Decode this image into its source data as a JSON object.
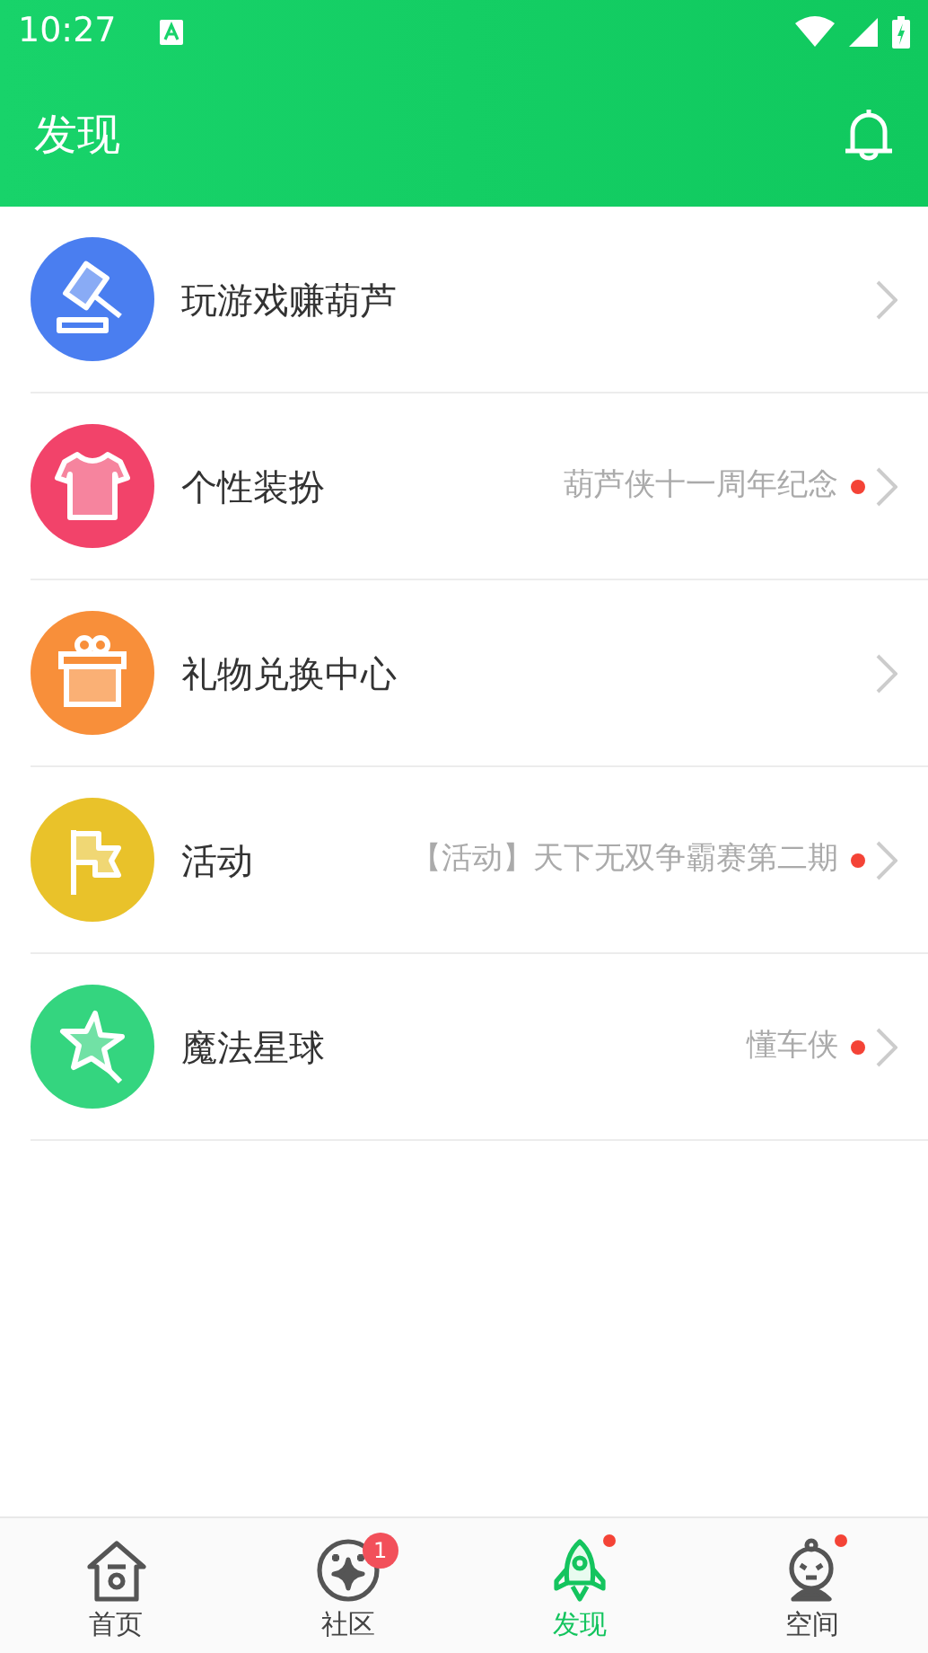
{
  "status_bar": {
    "time": "10:27"
  },
  "app_bar": {
    "title": "发现"
  },
  "items": [
    {
      "kind": "gavel",
      "color": "#4a7ef0",
      "title": "玩游戏赚葫芦",
      "has_new": false
    },
    {
      "kind": "shirt",
      "color": "#f2436a",
      "title": "个性装扮",
      "subtitle": "葫芦侠十一周年纪念",
      "has_new": true
    },
    {
      "kind": "gift",
      "color": "#f88f3a",
      "title": "礼物兑换中心",
      "has_new": false
    },
    {
      "kind": "flag",
      "color": "#e9c22a",
      "title": "活动",
      "subtitle": "【活动】天下无双争霸赛第二期",
      "has_new": true
    },
    {
      "kind": "star",
      "color": "#34d57f",
      "title": "魔法星球",
      "subtitle": "懂车侠",
      "has_new": true
    }
  ],
  "tabs": [
    {
      "kind": "home",
      "label": "首页",
      "selected": false,
      "has_dot": false
    },
    {
      "kind": "community",
      "label": "社区",
      "selected": false,
      "badge": "1",
      "has_dot": false
    },
    {
      "kind": "rocket",
      "label": "发现",
      "selected": true,
      "has_dot": true
    },
    {
      "kind": "face",
      "label": "空间",
      "selected": false,
      "has_dot": true
    }
  ]
}
